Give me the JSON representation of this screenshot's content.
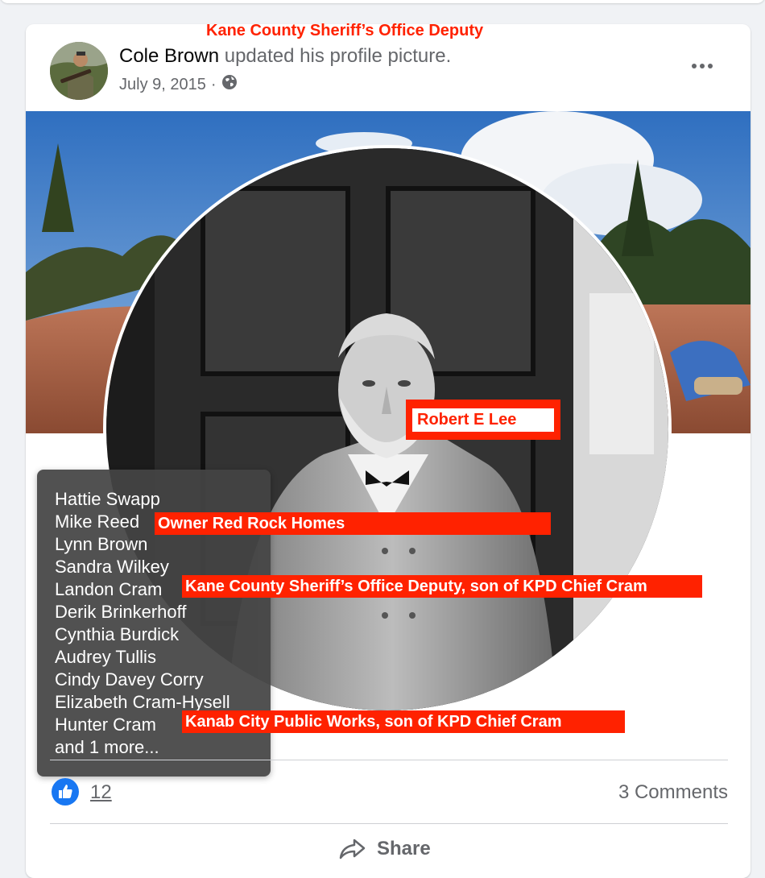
{
  "post": {
    "author": "Cole Brown",
    "action": "updated his profile picture.",
    "date": "July 9, 2015",
    "separator": "·",
    "privacy_icon": "globe-icon",
    "more_icon": "more-options-icon"
  },
  "annotations": {
    "top": "Kane County Sheriff’s Office Deputy",
    "lee": "Robert E Lee",
    "reed": "Owner Red Rock Homes",
    "landon": "Kane County Sheriff’s Office Deputy, son of KPD Chief Cram",
    "hunter": "Kanab City Public Works, son of KPD Chief Cram"
  },
  "likers_tooltip": [
    "Hattie Swapp",
    "Mike Reed",
    "Lynn Brown",
    "Sandra Wilkey",
    "Landon Cram",
    "Derik Brinkerhoff",
    "Cynthia Burdick",
    "Audrey Tullis",
    "Cindy Davey Corry",
    "Elizabeth Cram-Hysell",
    "Hunter Cram",
    "and 1 more..."
  ],
  "reactions": {
    "like_icon": "thumbs-up-icon",
    "count": "12",
    "comments": "3 Comments"
  },
  "actions": {
    "share_label": "Share",
    "share_icon": "share-arrow-icon"
  },
  "colors": {
    "annotation_red": "#ff2200",
    "like_blue": "#1877f2",
    "secondary_text": "#65676b"
  }
}
